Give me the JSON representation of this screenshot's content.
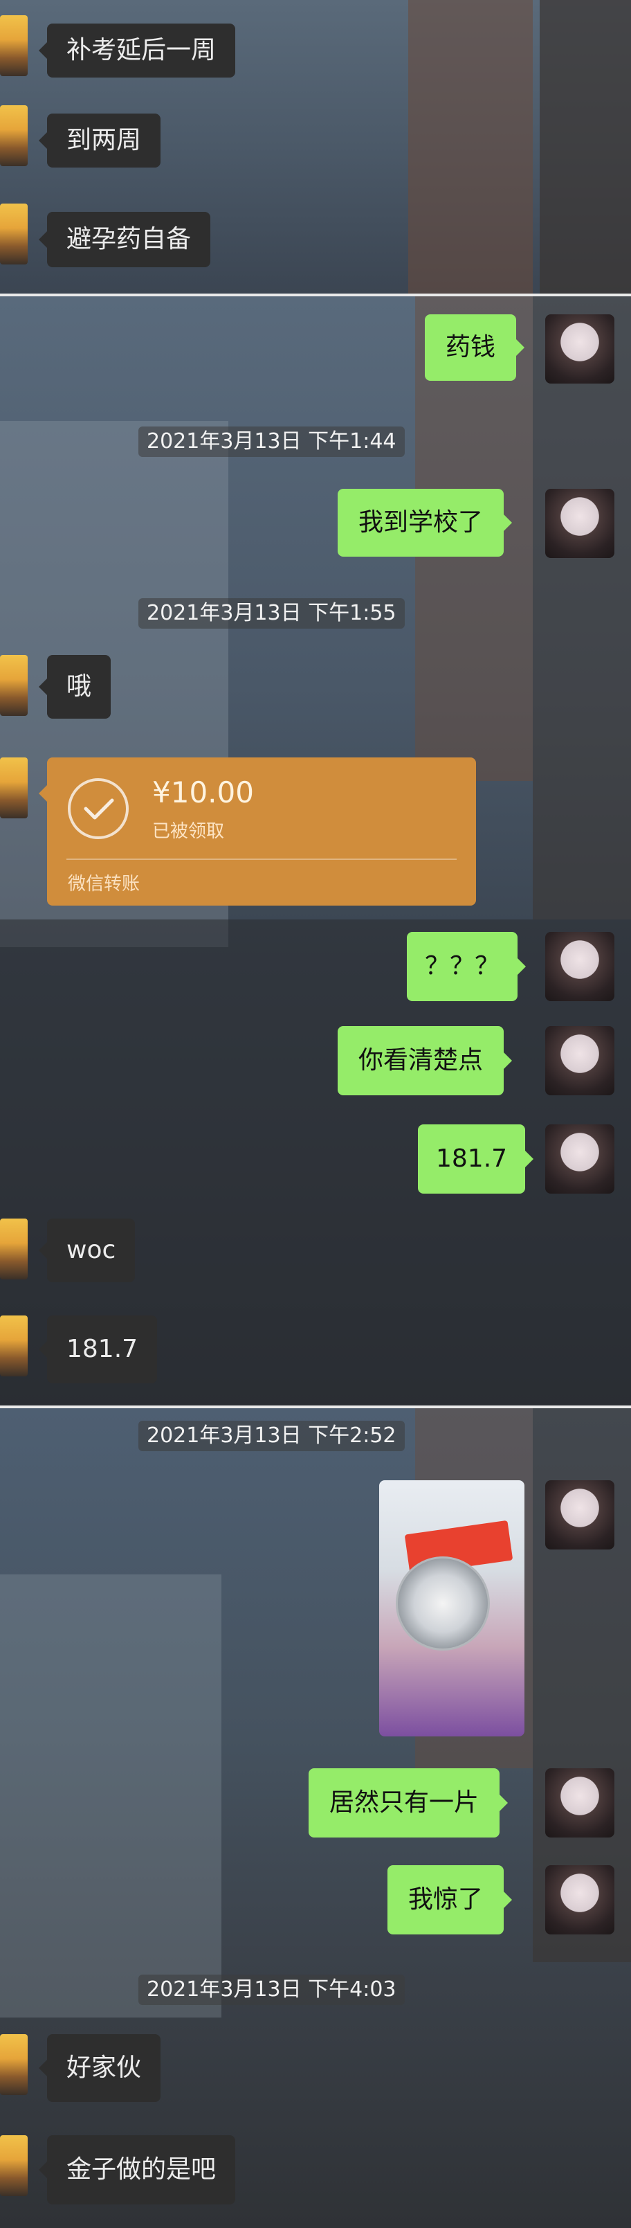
{
  "chat": {
    "panel1": [
      {
        "side": "left",
        "text": "补考延后一周"
      },
      {
        "side": "left",
        "text": "到两周"
      },
      {
        "side": "left",
        "text": "避孕药自备"
      }
    ],
    "panel2": {
      "msg_medicine_money": "药钱",
      "ts1": "2021年3月13日 下午1:44",
      "msg_arrived": "我到学校了",
      "ts2": "2021年3月13日 下午1:55",
      "msg_oh": "哦",
      "transfer": {
        "amount": "¥10.00",
        "status": "已被领取",
        "footer": "微信转账"
      },
      "msg_qqq": "？？？",
      "msg_look": "你看清楚点",
      "msg_181_right": "181.7",
      "msg_woc": "woc",
      "msg_181_left": "181.7"
    },
    "panel3": {
      "ts3": "2021年3月13日 下午2:52",
      "msg_only_one": "居然只有一片",
      "msg_shocked": "我惊了",
      "ts4": "2021年3月13日 下午4:03",
      "msg_good": "好家伙",
      "msg_gold": "金子做的是吧"
    }
  },
  "colors": {
    "sent_bubble": "#95ec69",
    "received_bubble": "#2e2e2e",
    "transfer_card": "#d08d3c"
  },
  "icons": {
    "transfer": "check-circle-icon"
  }
}
